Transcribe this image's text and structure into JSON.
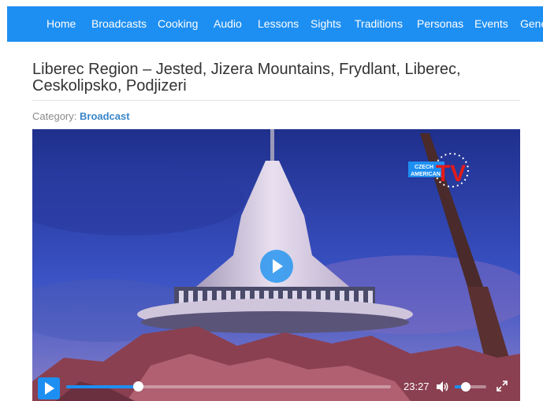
{
  "nav": {
    "items": [
      "Home",
      "Broadcasts",
      "Cooking",
      "Audio",
      "Lessons",
      "Sights",
      "Traditions",
      "Personas",
      "Events",
      "Gene"
    ]
  },
  "article": {
    "title": "Liberec Region – Jested, Jizera Mountains, Frydlant, Liberec, Ceskolipsko, Podjizeri",
    "category_label": "Category:",
    "category_value": "Broadcast"
  },
  "player": {
    "logo_text_1": "CZECH",
    "logo_text_2": "AMERICAN",
    "logo_text_3": "TV",
    "time": "23:27",
    "progress_fraction": 0.22,
    "volume_fraction": 0.35
  },
  "colors": {
    "accent": "#1e8ff2",
    "category_link": "#3a86c8"
  }
}
